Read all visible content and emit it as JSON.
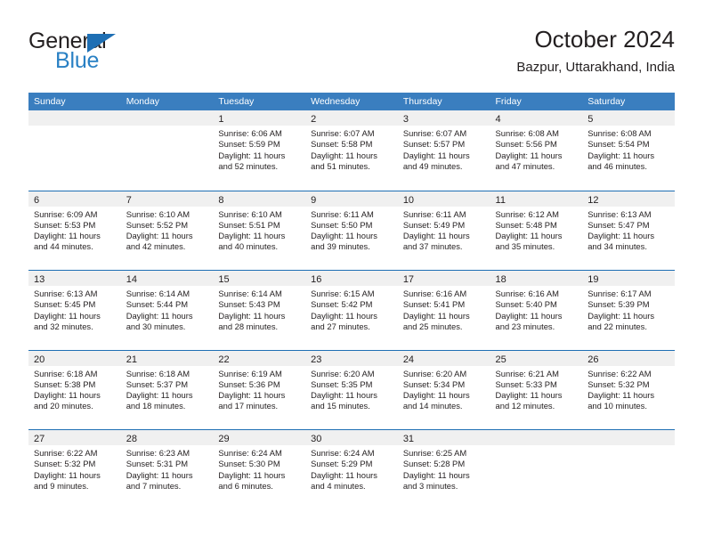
{
  "logo": {
    "word_one": "General",
    "word_two": "Blue",
    "triangle_icon": "triangle-icon",
    "accent_color": "#2980c4"
  },
  "header": {
    "title": "October 2024",
    "subtitle": "Bazpur, Uttarakhand, India"
  },
  "calendar": {
    "header_color": "#3a7ebf",
    "row_divider_color": "#1e6fb4",
    "daynum_band_color": "#f0f0f0",
    "weekdays": [
      "Sunday",
      "Monday",
      "Tuesday",
      "Wednesday",
      "Thursday",
      "Friday",
      "Saturday"
    ],
    "weeks": [
      [
        {
          "day": "",
          "lines": []
        },
        {
          "day": "",
          "lines": []
        },
        {
          "day": "1",
          "lines": [
            "Sunrise: 6:06 AM",
            "Sunset: 5:59 PM",
            "Daylight: 11 hours",
            "and 52 minutes."
          ]
        },
        {
          "day": "2",
          "lines": [
            "Sunrise: 6:07 AM",
            "Sunset: 5:58 PM",
            "Daylight: 11 hours",
            "and 51 minutes."
          ]
        },
        {
          "day": "3",
          "lines": [
            "Sunrise: 6:07 AM",
            "Sunset: 5:57 PM",
            "Daylight: 11 hours",
            "and 49 minutes."
          ]
        },
        {
          "day": "4",
          "lines": [
            "Sunrise: 6:08 AM",
            "Sunset: 5:56 PM",
            "Daylight: 11 hours",
            "and 47 minutes."
          ]
        },
        {
          "day": "5",
          "lines": [
            "Sunrise: 6:08 AM",
            "Sunset: 5:54 PM",
            "Daylight: 11 hours",
            "and 46 minutes."
          ]
        }
      ],
      [
        {
          "day": "6",
          "lines": [
            "Sunrise: 6:09 AM",
            "Sunset: 5:53 PM",
            "Daylight: 11 hours",
            "and 44 minutes."
          ]
        },
        {
          "day": "7",
          "lines": [
            "Sunrise: 6:10 AM",
            "Sunset: 5:52 PM",
            "Daylight: 11 hours",
            "and 42 minutes."
          ]
        },
        {
          "day": "8",
          "lines": [
            "Sunrise: 6:10 AM",
            "Sunset: 5:51 PM",
            "Daylight: 11 hours",
            "and 40 minutes."
          ]
        },
        {
          "day": "9",
          "lines": [
            "Sunrise: 6:11 AM",
            "Sunset: 5:50 PM",
            "Daylight: 11 hours",
            "and 39 minutes."
          ]
        },
        {
          "day": "10",
          "lines": [
            "Sunrise: 6:11 AM",
            "Sunset: 5:49 PM",
            "Daylight: 11 hours",
            "and 37 minutes."
          ]
        },
        {
          "day": "11",
          "lines": [
            "Sunrise: 6:12 AM",
            "Sunset: 5:48 PM",
            "Daylight: 11 hours",
            "and 35 minutes."
          ]
        },
        {
          "day": "12",
          "lines": [
            "Sunrise: 6:13 AM",
            "Sunset: 5:47 PM",
            "Daylight: 11 hours",
            "and 34 minutes."
          ]
        }
      ],
      [
        {
          "day": "13",
          "lines": [
            "Sunrise: 6:13 AM",
            "Sunset: 5:45 PM",
            "Daylight: 11 hours",
            "and 32 minutes."
          ]
        },
        {
          "day": "14",
          "lines": [
            "Sunrise: 6:14 AM",
            "Sunset: 5:44 PM",
            "Daylight: 11 hours",
            "and 30 minutes."
          ]
        },
        {
          "day": "15",
          "lines": [
            "Sunrise: 6:14 AM",
            "Sunset: 5:43 PM",
            "Daylight: 11 hours",
            "and 28 minutes."
          ]
        },
        {
          "day": "16",
          "lines": [
            "Sunrise: 6:15 AM",
            "Sunset: 5:42 PM",
            "Daylight: 11 hours",
            "and 27 minutes."
          ]
        },
        {
          "day": "17",
          "lines": [
            "Sunrise: 6:16 AM",
            "Sunset: 5:41 PM",
            "Daylight: 11 hours",
            "and 25 minutes."
          ]
        },
        {
          "day": "18",
          "lines": [
            "Sunrise: 6:16 AM",
            "Sunset: 5:40 PM",
            "Daylight: 11 hours",
            "and 23 minutes."
          ]
        },
        {
          "day": "19",
          "lines": [
            "Sunrise: 6:17 AM",
            "Sunset: 5:39 PM",
            "Daylight: 11 hours",
            "and 22 minutes."
          ]
        }
      ],
      [
        {
          "day": "20",
          "lines": [
            "Sunrise: 6:18 AM",
            "Sunset: 5:38 PM",
            "Daylight: 11 hours",
            "and 20 minutes."
          ]
        },
        {
          "day": "21",
          "lines": [
            "Sunrise: 6:18 AM",
            "Sunset: 5:37 PM",
            "Daylight: 11 hours",
            "and 18 minutes."
          ]
        },
        {
          "day": "22",
          "lines": [
            "Sunrise: 6:19 AM",
            "Sunset: 5:36 PM",
            "Daylight: 11 hours",
            "and 17 minutes."
          ]
        },
        {
          "day": "23",
          "lines": [
            "Sunrise: 6:20 AM",
            "Sunset: 5:35 PM",
            "Daylight: 11 hours",
            "and 15 minutes."
          ]
        },
        {
          "day": "24",
          "lines": [
            "Sunrise: 6:20 AM",
            "Sunset: 5:34 PM",
            "Daylight: 11 hours",
            "and 14 minutes."
          ]
        },
        {
          "day": "25",
          "lines": [
            "Sunrise: 6:21 AM",
            "Sunset: 5:33 PM",
            "Daylight: 11 hours",
            "and 12 minutes."
          ]
        },
        {
          "day": "26",
          "lines": [
            "Sunrise: 6:22 AM",
            "Sunset: 5:32 PM",
            "Daylight: 11 hours",
            "and 10 minutes."
          ]
        }
      ],
      [
        {
          "day": "27",
          "lines": [
            "Sunrise: 6:22 AM",
            "Sunset: 5:32 PM",
            "Daylight: 11 hours",
            "and 9 minutes."
          ]
        },
        {
          "day": "28",
          "lines": [
            "Sunrise: 6:23 AM",
            "Sunset: 5:31 PM",
            "Daylight: 11 hours",
            "and 7 minutes."
          ]
        },
        {
          "day": "29",
          "lines": [
            "Sunrise: 6:24 AM",
            "Sunset: 5:30 PM",
            "Daylight: 11 hours",
            "and 6 minutes."
          ]
        },
        {
          "day": "30",
          "lines": [
            "Sunrise: 6:24 AM",
            "Sunset: 5:29 PM",
            "Daylight: 11 hours",
            "and 4 minutes."
          ]
        },
        {
          "day": "31",
          "lines": [
            "Sunrise: 6:25 AM",
            "Sunset: 5:28 PM",
            "Daylight: 11 hours",
            "and 3 minutes."
          ]
        },
        {
          "day": "",
          "lines": []
        },
        {
          "day": "",
          "lines": []
        }
      ]
    ]
  }
}
